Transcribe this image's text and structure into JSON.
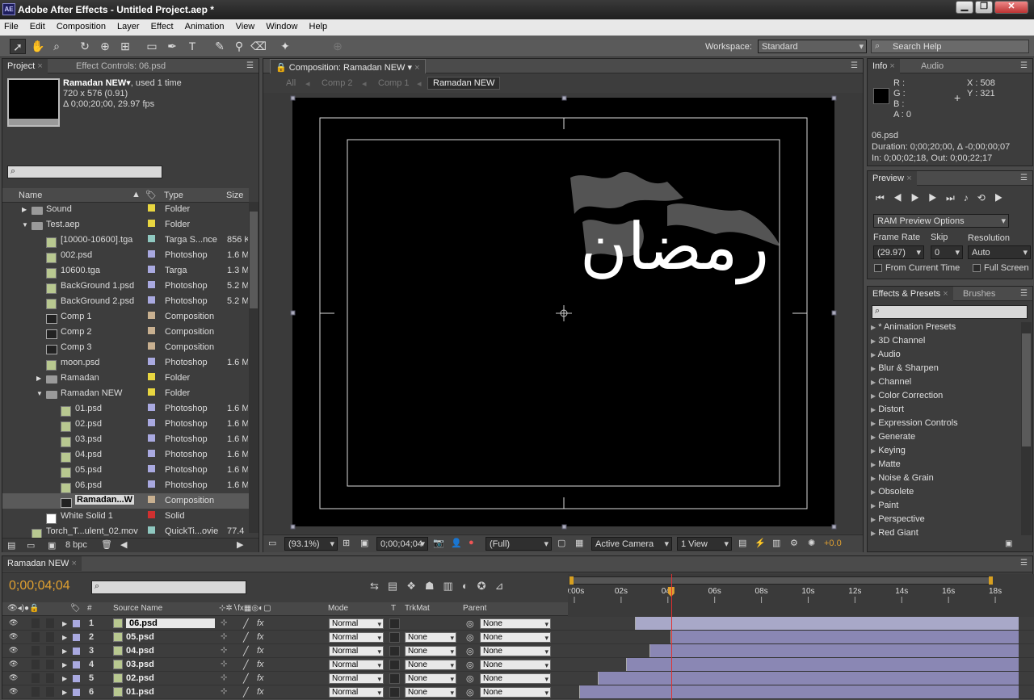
{
  "app": {
    "title": "Adobe After Effects - Untitled Project.aep *",
    "logo": "AE"
  },
  "menu": [
    "File",
    "Edit",
    "Composition",
    "Layer",
    "Effect",
    "Animation",
    "View",
    "Window",
    "Help"
  ],
  "toolbar": {
    "workspace_label": "Workspace:",
    "workspace_value": "Standard",
    "search_placeholder": "Search Help"
  },
  "project": {
    "tab_project": "Project",
    "tab_effect_controls": "Effect Controls: 06.psd",
    "item_name": "Ramadan NEW",
    "item_used": ", used 1 time",
    "item_dims": "720 x 576 (0.91)",
    "item_duration": "Δ 0;00;20;00, 29.97 fps",
    "columns": {
      "name": "Name",
      "type": "Type",
      "size": "Size"
    },
    "rows": [
      {
        "name": "Sound",
        "type": "Folder",
        "size": "",
        "kind": "folder",
        "indent": 0,
        "color": "#e8d640",
        "arrow": "▶"
      },
      {
        "name": "Test.aep",
        "type": "Folder",
        "size": "",
        "kind": "folder",
        "indent": 0,
        "color": "#e8d640",
        "arrow": "▼"
      },
      {
        "name": "[10000-10600].tga",
        "type": "Targa S...nce",
        "size": "856 K",
        "kind": "file",
        "indent": 1,
        "color": "#8fc8c0",
        "arrow": ""
      },
      {
        "name": "002.psd",
        "type": "Photoshop",
        "size": "1.6 M",
        "kind": "file",
        "indent": 1,
        "color": "#a9a9e0",
        "arrow": ""
      },
      {
        "name": "10600.tga",
        "type": "Targa",
        "size": "1.3 M",
        "kind": "file",
        "indent": 1,
        "color": "#a9a9e0",
        "arrow": ""
      },
      {
        "name": "BackGround 1.psd",
        "type": "Photoshop",
        "size": "5.2 M",
        "kind": "file",
        "indent": 1,
        "color": "#a9a9e0",
        "arrow": ""
      },
      {
        "name": "BackGround 2.psd",
        "type": "Photoshop",
        "size": "5.2 M",
        "kind": "file",
        "indent": 1,
        "color": "#a9a9e0",
        "arrow": ""
      },
      {
        "name": "Comp 1",
        "type": "Composition",
        "size": "",
        "kind": "comp",
        "indent": 1,
        "color": "#c8b090",
        "arrow": ""
      },
      {
        "name": "Comp 2",
        "type": "Composition",
        "size": "",
        "kind": "comp",
        "indent": 1,
        "color": "#c8b090",
        "arrow": ""
      },
      {
        "name": "Comp 3",
        "type": "Composition",
        "size": "",
        "kind": "comp",
        "indent": 1,
        "color": "#c8b090",
        "arrow": ""
      },
      {
        "name": "moon.psd",
        "type": "Photoshop",
        "size": "1.6 M",
        "kind": "file",
        "indent": 1,
        "color": "#a9a9e0",
        "arrow": ""
      },
      {
        "name": "Ramadan",
        "type": "Folder",
        "size": "",
        "kind": "folder",
        "indent": 1,
        "color": "#e8d640",
        "arrow": "▶"
      },
      {
        "name": "Ramadan NEW",
        "type": "Folder",
        "size": "",
        "kind": "folder",
        "indent": 1,
        "color": "#e8d640",
        "arrow": "▼"
      },
      {
        "name": "01.psd",
        "type": "Photoshop",
        "size": "1.6 M",
        "kind": "file",
        "indent": 2,
        "color": "#a9a9e0",
        "arrow": ""
      },
      {
        "name": "02.psd",
        "type": "Photoshop",
        "size": "1.6 M",
        "kind": "file",
        "indent": 2,
        "color": "#a9a9e0",
        "arrow": ""
      },
      {
        "name": "03.psd",
        "type": "Photoshop",
        "size": "1.6 M",
        "kind": "file",
        "indent": 2,
        "color": "#a9a9e0",
        "arrow": ""
      },
      {
        "name": "04.psd",
        "type": "Photoshop",
        "size": "1.6 M",
        "kind": "file",
        "indent": 2,
        "color": "#a9a9e0",
        "arrow": ""
      },
      {
        "name": "05.psd",
        "type": "Photoshop",
        "size": "1.6 M",
        "kind": "file",
        "indent": 2,
        "color": "#a9a9e0",
        "arrow": ""
      },
      {
        "name": "06.psd",
        "type": "Photoshop",
        "size": "1.6 M",
        "kind": "file",
        "indent": 2,
        "color": "#a9a9e0",
        "arrow": ""
      },
      {
        "name": "Ramadan...W",
        "type": "Composition",
        "size": "",
        "kind": "comp",
        "indent": 2,
        "color": "#c8b090",
        "arrow": "",
        "selected": true
      },
      {
        "name": "White Solid 1",
        "type": "Solid",
        "size": "",
        "kind": "solid",
        "indent": 1,
        "color": "#d03030",
        "arrow": ""
      },
      {
        "name": "Torch_T...ulent_02.mov",
        "type": "QuickTi...ovie",
        "size": "77.4",
        "kind": "file",
        "indent": 0,
        "color": "#8fc8c0",
        "arrow": ""
      }
    ],
    "bpc": "8 bpc"
  },
  "comp": {
    "tab": "Composition: Ramadan NEW",
    "crumbs": [
      "All",
      "Comp 2",
      "Comp 1",
      "Ramadan NEW"
    ],
    "arabic_text": "رمضان",
    "zoom": "(93.1%)",
    "timecode": "0;00;04;04",
    "resolution": "(Full)",
    "camera": "Active Camera",
    "views": "1 View",
    "exposure": "+0.0"
  },
  "info": {
    "tab_info": "Info",
    "tab_audio": "Audio",
    "r": "R :",
    "g": "G :",
    "b": "B :",
    "a": "A : 0",
    "x": "X : 508",
    "y": "Y : 321",
    "file": "06.psd",
    "duration": "Duration: 0;00;20;00, Δ -0;00;00;07",
    "inout": "In: 0;00;02;18, Out: 0;00;22;17"
  },
  "preview": {
    "tab": "Preview",
    "ram": "RAM Preview Options",
    "frame_rate_label": "Frame Rate",
    "skip_label": "Skip",
    "resolution_label": "Resolution",
    "frame_rate": "(29.97)",
    "skip": "0",
    "resolution": "Auto",
    "from_current": "From Current Time",
    "full_screen": "Full Screen"
  },
  "effects": {
    "tab": "Effects & Presets",
    "tab_brushes": "Brushes",
    "items": [
      "* Animation Presets",
      "3D Channel",
      "Audio",
      "Blur & Sharpen",
      "Channel",
      "Color Correction",
      "Distort",
      "Expression Controls",
      "Generate",
      "Keying",
      "Matte",
      "Noise & Grain",
      "Obsolete",
      "Paint",
      "Perspective",
      "Red Giant"
    ]
  },
  "timeline": {
    "tab": "Ramadan NEW",
    "timecode": "0;00;04;04",
    "columns": {
      "source": "Source Name",
      "mode": "Mode",
      "t": "T",
      "trkmat": "TrkMat",
      "parent": "Parent"
    },
    "ruler": [
      "0:00s",
      "02s",
      "04s",
      "06s",
      "08s",
      "10s",
      "12s",
      "14s",
      "16s",
      "18s"
    ],
    "layers": [
      {
        "num": "1",
        "name": "06.psd",
        "mode": "Normal",
        "trkmat": "",
        "parent": "None",
        "start": 2.6
      },
      {
        "num": "2",
        "name": "05.psd",
        "mode": "Normal",
        "trkmat": "None",
        "parent": "None",
        "start": 4.1
      },
      {
        "num": "3",
        "name": "04.psd",
        "mode": "Normal",
        "trkmat": "None",
        "parent": "None",
        "start": 3.2
      },
      {
        "num": "4",
        "name": "03.psd",
        "mode": "Normal",
        "trkmat": "None",
        "parent": "None",
        "start": 2.2
      },
      {
        "num": "5",
        "name": "02.psd",
        "mode": "Normal",
        "trkmat": "None",
        "parent": "None",
        "start": 1.0
      },
      {
        "num": "6",
        "name": "01.psd",
        "mode": "Normal",
        "trkmat": "None",
        "parent": "None",
        "start": 0.2
      }
    ],
    "current_time": 4.14,
    "duration": 20
  }
}
